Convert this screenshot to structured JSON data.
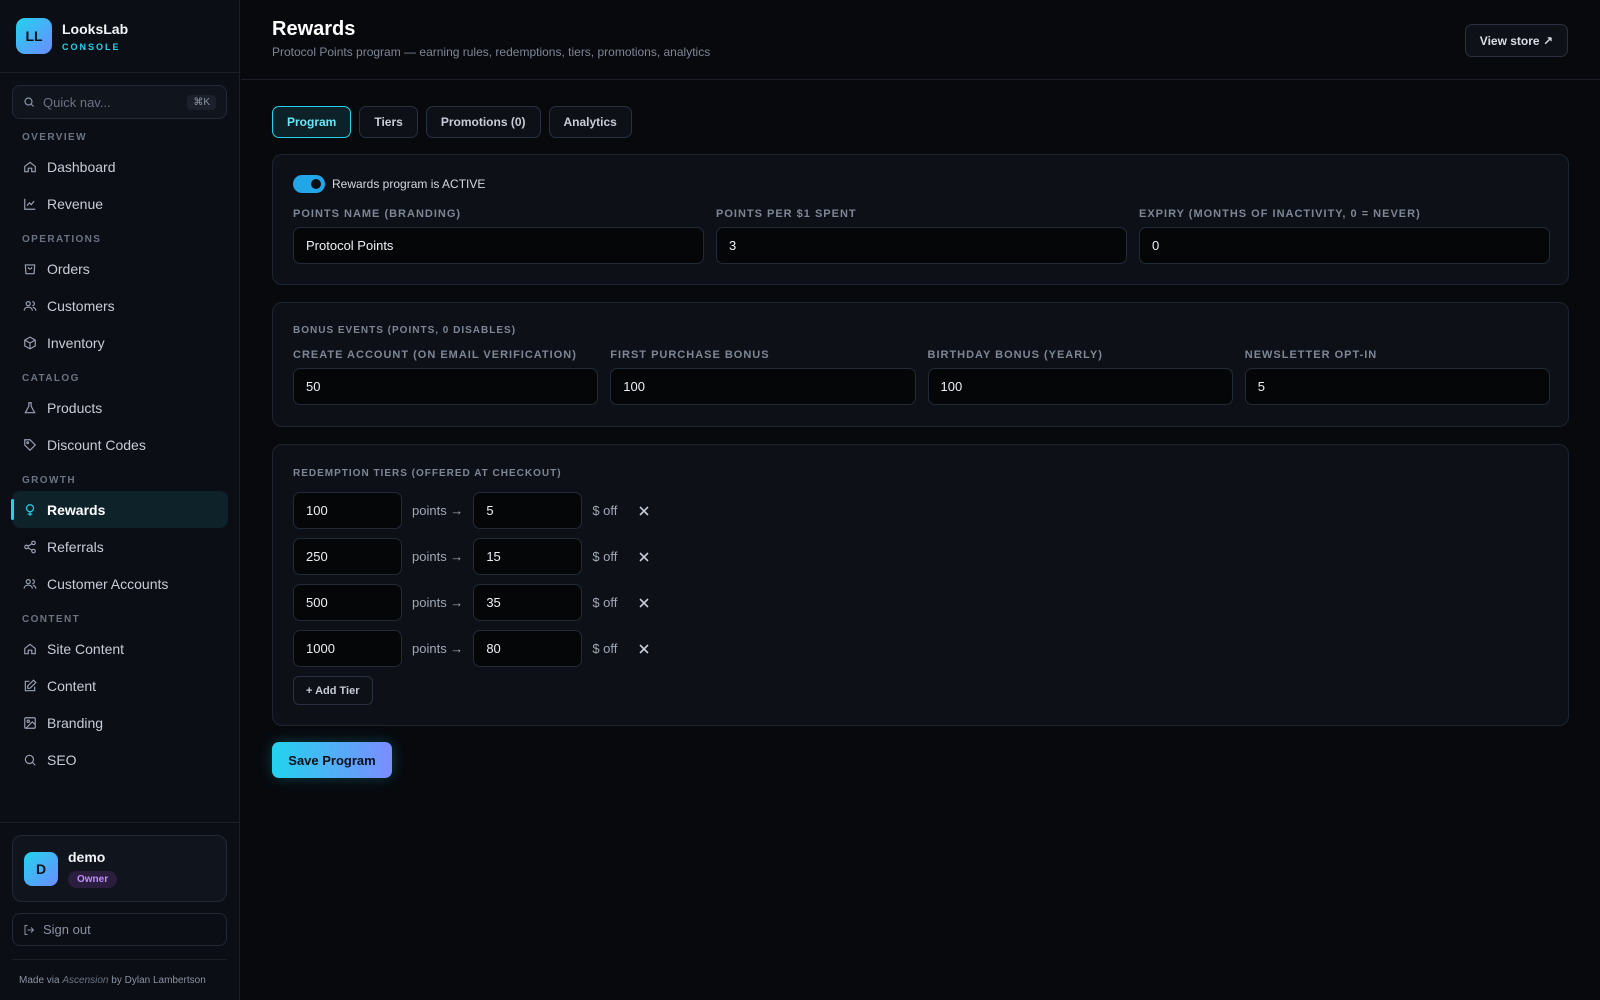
{
  "brand": {
    "logo": "LL",
    "name": "LooksLab",
    "sub": "CONSOLE"
  },
  "quicknav": {
    "placeholder": "Quick nav...",
    "shortcut": "⌘K",
    "icon": "search-icon"
  },
  "nav": [
    {
      "section": "OVERVIEW",
      "items": [
        {
          "label": "Dashboard",
          "icon": "home-icon",
          "key": "dashboard"
        },
        {
          "label": "Revenue",
          "icon": "chart-line-icon",
          "key": "revenue"
        }
      ]
    },
    {
      "section": "OPERATIONS",
      "items": [
        {
          "label": "Orders",
          "icon": "box-icon",
          "key": "orders"
        },
        {
          "label": "Customers",
          "icon": "users-icon",
          "key": "customers"
        },
        {
          "label": "Inventory",
          "icon": "package-icon",
          "key": "inventory"
        }
      ]
    },
    {
      "section": "CATALOG",
      "items": [
        {
          "label": "Products",
          "icon": "flask-icon",
          "key": "products"
        },
        {
          "label": "Discount Codes",
          "icon": "tag-icon",
          "key": "discount-codes"
        }
      ]
    },
    {
      "section": "GROWTH",
      "items": [
        {
          "label": "Rewards",
          "icon": "award-icon",
          "key": "rewards",
          "active": true
        },
        {
          "label": "Referrals",
          "icon": "share-icon",
          "key": "referrals"
        },
        {
          "label": "Customer Accounts",
          "icon": "users-icon",
          "key": "customer-accounts"
        }
      ]
    },
    {
      "section": "CONTENT",
      "items": [
        {
          "label": "Site Content",
          "icon": "home-icon",
          "key": "site-content"
        },
        {
          "label": "Content",
          "icon": "edit-icon",
          "key": "content"
        },
        {
          "label": "Branding",
          "icon": "image-icon",
          "key": "branding"
        },
        {
          "label": "SEO",
          "icon": "search-icon",
          "key": "seo"
        }
      ]
    }
  ],
  "user": {
    "initial": "D",
    "name": "demo",
    "role": "Owner"
  },
  "signout": {
    "label": "Sign out",
    "icon": "sign-out-icon"
  },
  "footer": {
    "prefix": "Made via",
    "tool": "Ascension",
    "suffix": "by Dylan Lambertson"
  },
  "header": {
    "title": "Rewards",
    "subtitle": "Protocol Points program — earning rules, redemptions, tiers, promotions, analytics",
    "view_store": "View store ↗"
  },
  "tabs": [
    {
      "label": "Program",
      "active": true
    },
    {
      "label": "Tiers"
    },
    {
      "label": "Promotions (0)"
    },
    {
      "label": "Analytics"
    }
  ],
  "program": {
    "toggle_label": "Rewards program is ACTIVE",
    "fields": [
      {
        "label": "POINTS NAME (BRANDING)",
        "value": "Protocol Points"
      },
      {
        "label": "POINTS PER $1 SPENT",
        "value": "3"
      },
      {
        "label": "EXPIRY (MONTHS OF INACTIVITY, 0 = NEVER)",
        "value": "0"
      }
    ]
  },
  "bonus": {
    "title": "BONUS EVENTS (POINTS, 0 DISABLES)",
    "fields": [
      {
        "label": "CREATE ACCOUNT (ON EMAIL VERIFICATION)",
        "value": "50"
      },
      {
        "label": "FIRST PURCHASE BONUS",
        "value": "100"
      },
      {
        "label": "BIRTHDAY BONUS (YEARLY)",
        "value": "100"
      },
      {
        "label": "NEWSLETTER OPT-IN",
        "value": "5"
      }
    ]
  },
  "redemption": {
    "title": "REDEMPTION TIERS (OFFERED AT CHECKOUT)",
    "points_text": "points →",
    "off_text": "$ off",
    "tiers": [
      {
        "points": "100",
        "off": "5"
      },
      {
        "points": "250",
        "off": "15"
      },
      {
        "points": "500",
        "off": "35"
      },
      {
        "points": "1000",
        "off": "80"
      }
    ],
    "add_label": "+ Add Tier"
  },
  "save_label": "Save Program"
}
